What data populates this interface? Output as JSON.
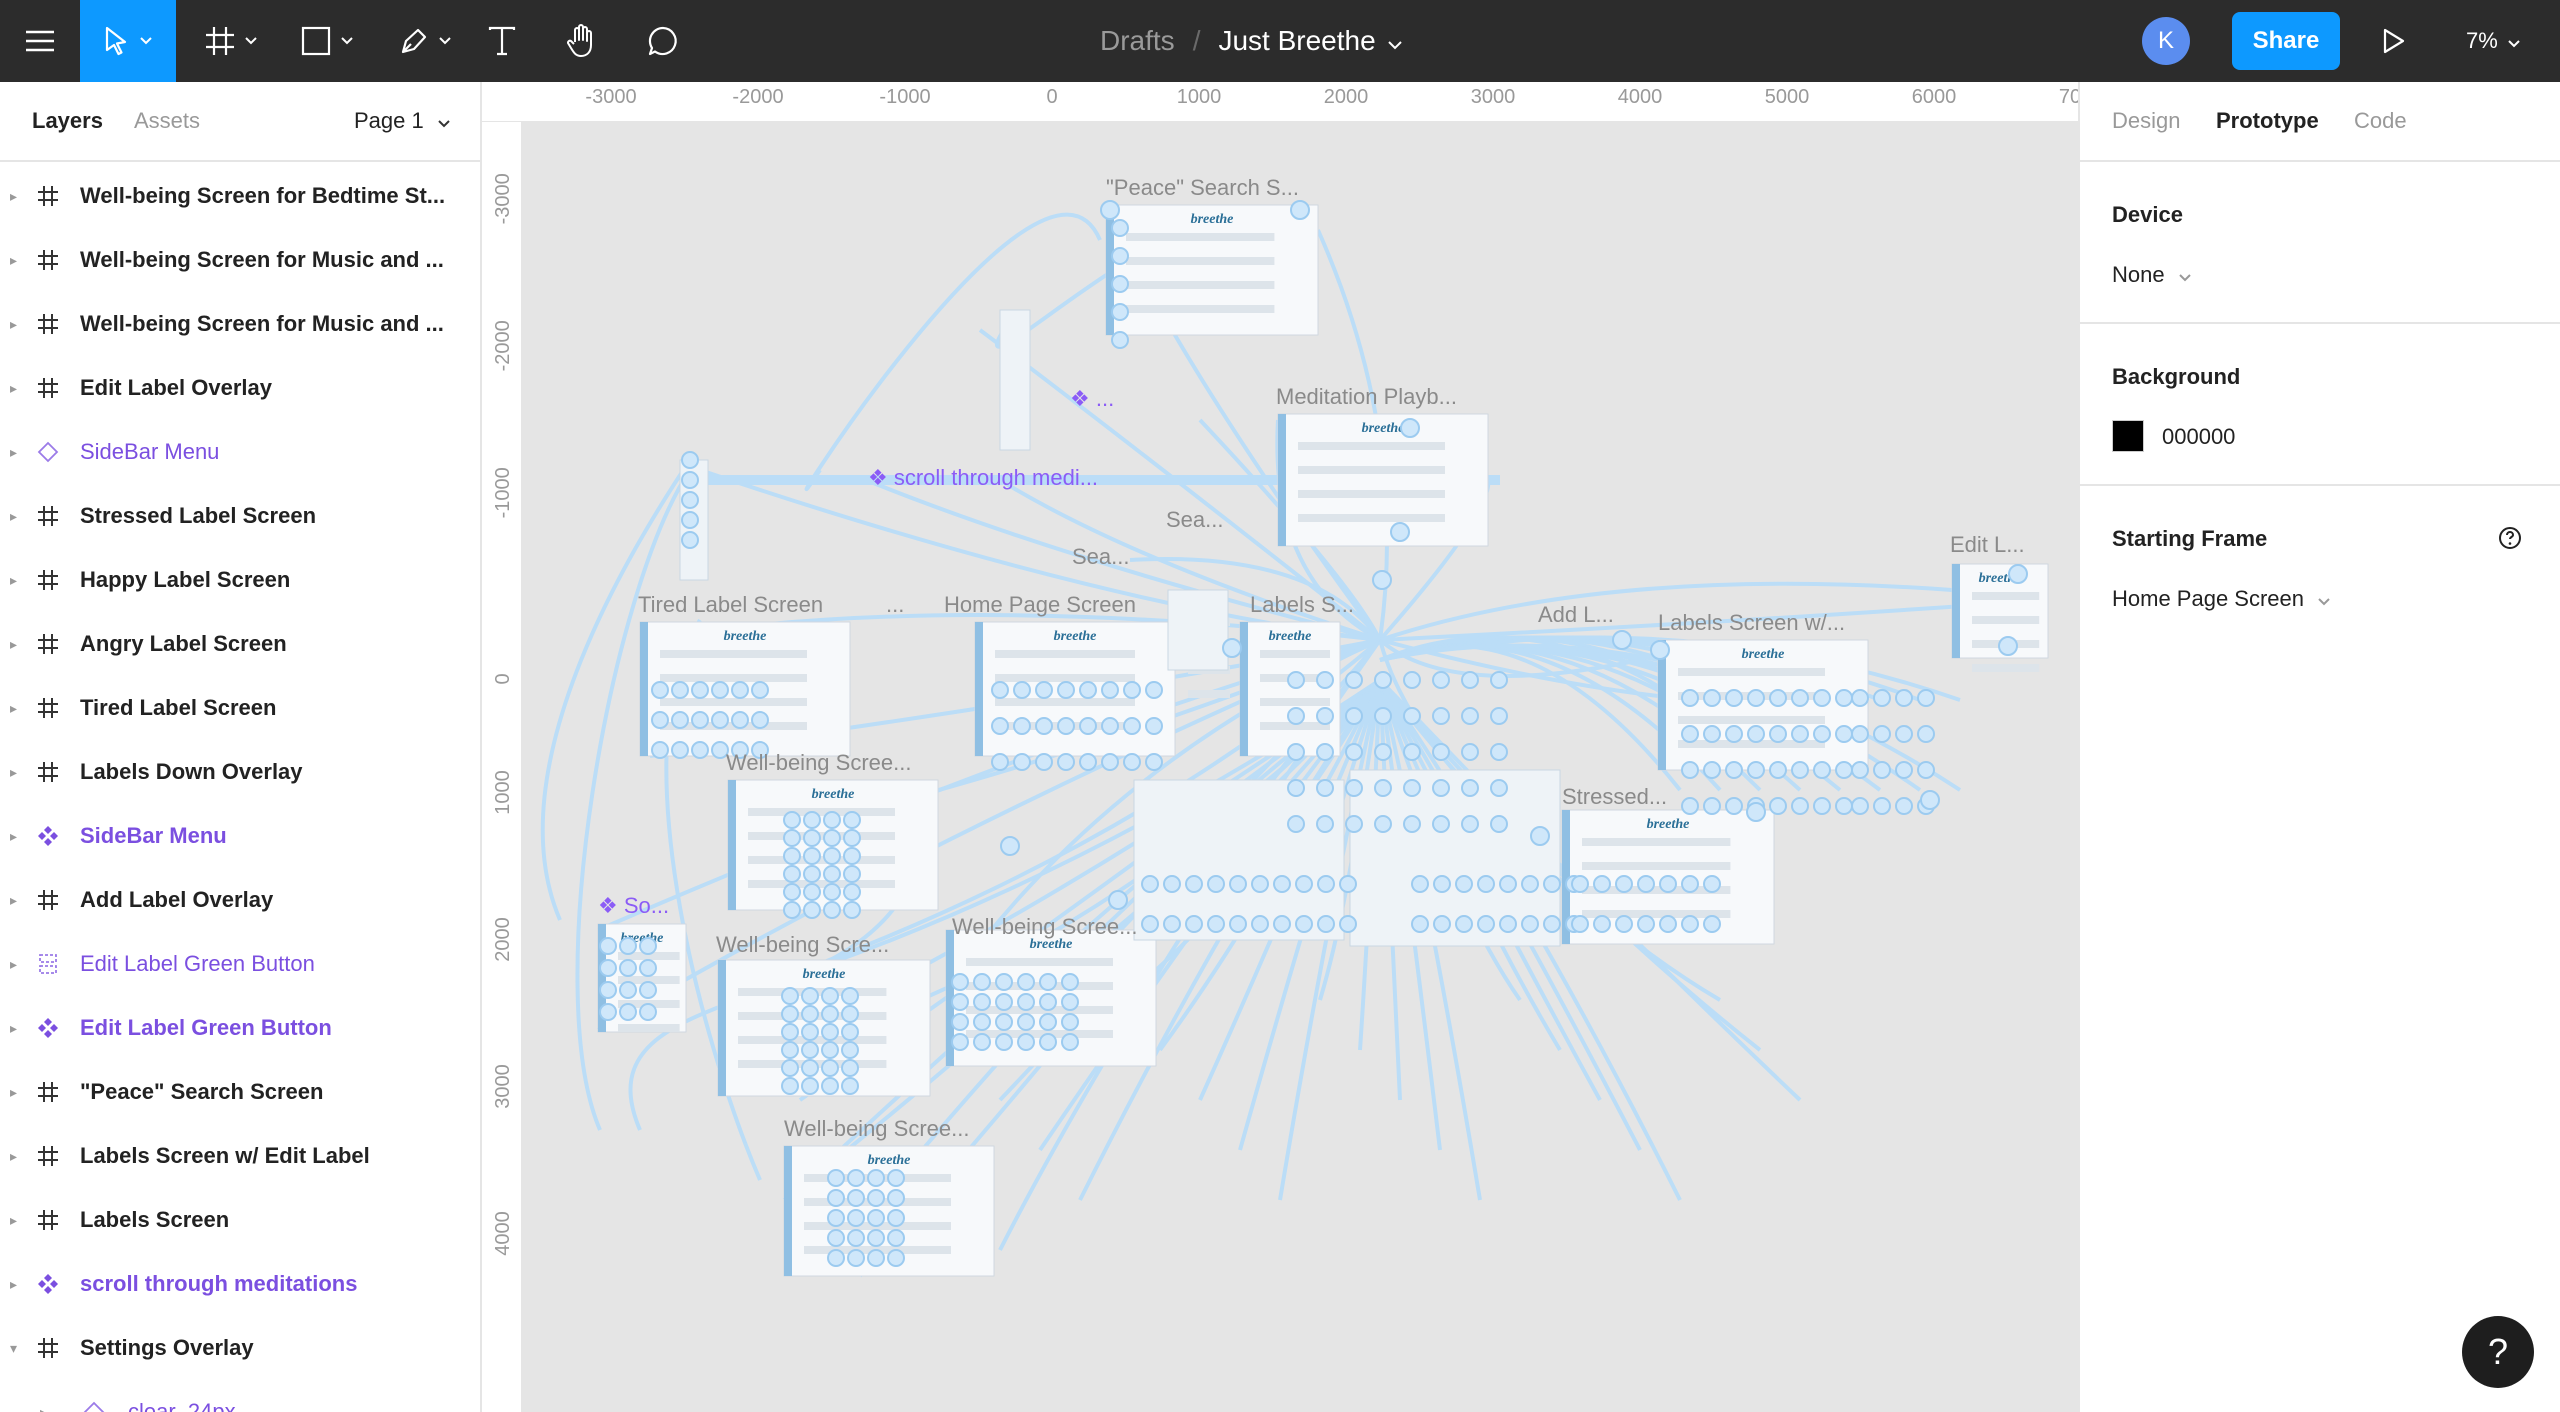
{
  "toolbar": {
    "breadcrumb_root": "Drafts",
    "breadcrumb_sep": "/",
    "file_name": "Just Breethe",
    "avatar_initial": "K",
    "share_label": "Share",
    "zoom_level": "7%",
    "icons": [
      "main-menu-icon",
      "move-tool-icon",
      "frame-tool-icon",
      "shape-tool-icon",
      "pen-tool-icon",
      "text-tool-icon",
      "hand-tool-icon",
      "comment-tool-icon",
      "present-icon"
    ]
  },
  "left_panel": {
    "tab_layers": "Layers",
    "tab_assets": "Assets",
    "page_label": "Page 1",
    "layers": [
      {
        "name": "Well-being Screen for Bedtime St...",
        "type": "frame"
      },
      {
        "name": "Well-being Screen for Music and ...",
        "type": "frame"
      },
      {
        "name": "Well-being Screen for Music and ...",
        "type": "frame"
      },
      {
        "name": "Edit Label Overlay",
        "type": "frame"
      },
      {
        "name": "SideBar Menu",
        "type": "instance"
      },
      {
        "name": "Stressed Label Screen",
        "type": "frame"
      },
      {
        "name": "Happy Label Screen",
        "type": "frame"
      },
      {
        "name": "Angry Label Screen",
        "type": "frame"
      },
      {
        "name": "Tired Label Screen",
        "type": "frame"
      },
      {
        "name": "Labels Down Overlay",
        "type": "frame"
      },
      {
        "name": "SideBar Menu",
        "type": "component"
      },
      {
        "name": "Add Label Overlay",
        "type": "frame"
      },
      {
        "name": "Edit Label Green Button",
        "type": "variant-set"
      },
      {
        "name": "Edit Label Green Button",
        "type": "component"
      },
      {
        "name": "\"Peace\" Search Screen",
        "type": "frame"
      },
      {
        "name": "Labels Screen w/ Edit Label",
        "type": "frame"
      },
      {
        "name": "Labels Screen",
        "type": "frame"
      },
      {
        "name": "scroll through meditations",
        "type": "component"
      },
      {
        "name": "Settings Overlay",
        "type": "frame",
        "expanded": true
      },
      {
        "name": "clear_24px",
        "type": "child"
      }
    ]
  },
  "rulers": {
    "x_labels": [
      "-3000",
      "-2000",
      "-1000",
      "0",
      "1000",
      "2000",
      "3000",
      "4000",
      "5000",
      "6000",
      "70"
    ],
    "y_labels": [
      "-3000",
      "-2000",
      "-1000",
      "0",
      "1000",
      "2000",
      "3000",
      "4000"
    ]
  },
  "canvas": {
    "frames": [
      {
        "title": "\"Peace\" Search S...",
        "kind": "frame"
      },
      {
        "title": "Meditation Playb...",
        "kind": "frame"
      },
      {
        "title": "scroll through medi...",
        "kind": "component"
      },
      {
        "title": "Sea...",
        "kind": "frame"
      },
      {
        "title": "Sea...",
        "kind": "frame"
      },
      {
        "title": "...",
        "kind": "component"
      },
      {
        "title": "Tired Label Screen",
        "kind": "frame"
      },
      {
        "title": "...",
        "kind": "frame"
      },
      {
        "title": "Home Page Screen",
        "kind": "frame"
      },
      {
        "title": "Labels S...",
        "kind": "frame"
      },
      {
        "title": "Add L...",
        "kind": "frame"
      },
      {
        "title": "Labels Screen w/...",
        "kind": "frame"
      },
      {
        "title": "Edit L...",
        "kind": "frame"
      },
      {
        "title": "Well-being Scree...",
        "kind": "frame"
      },
      {
        "title": "Stressed...",
        "kind": "frame"
      },
      {
        "title": "So...",
        "kind": "component"
      },
      {
        "title": "Well-being Scre...",
        "kind": "frame"
      },
      {
        "title": "Well-being Scree...",
        "kind": "frame"
      },
      {
        "title": "Well-being Scree...",
        "kind": "frame"
      }
    ],
    "connection_color": "#b9ddf8",
    "frame_brand_text": "breethe"
  },
  "right_panel": {
    "tabs": [
      "Design",
      "Prototype",
      "Code"
    ],
    "active_tab": "Prototype",
    "device_heading": "Device",
    "device_value": "None",
    "background_heading": "Background",
    "background_hex": "000000",
    "background_color": "#000000",
    "starting_frame_heading": "Starting Frame",
    "starting_frame_value": "Home Page Screen",
    "help_label": "?"
  }
}
